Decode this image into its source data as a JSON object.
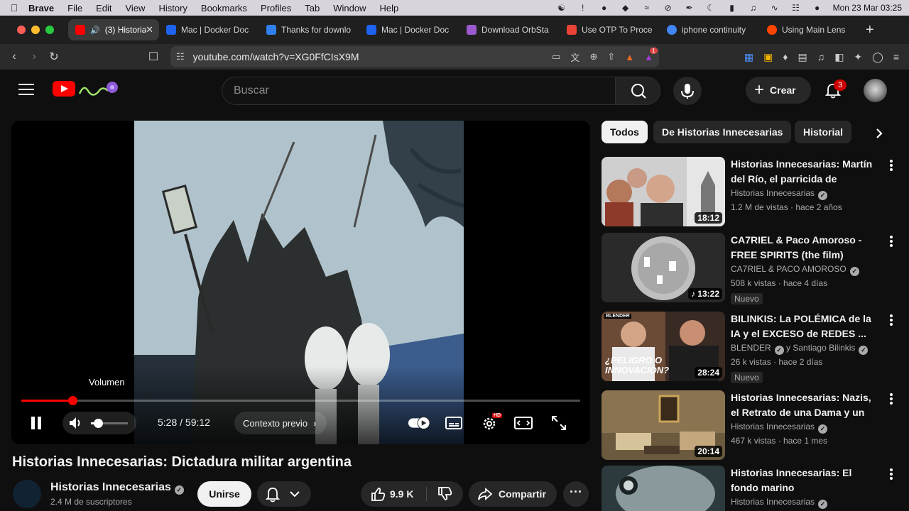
{
  "menubar": {
    "app": "Brave",
    "items": [
      "File",
      "Edit",
      "View",
      "History",
      "Bookmarks",
      "Profiles",
      "Tab",
      "Window",
      "Help"
    ],
    "clock": "Mon 23 Mar  03:25"
  },
  "tabs": [
    {
      "label": "(3) Historia",
      "color": "#ff0000"
    },
    {
      "label": "Mac | Docker Doc",
      "color": "#1d63ed"
    },
    {
      "label": "Thanks for downlo",
      "color": "#2f80ed"
    },
    {
      "label": "Mac | Docker Doc",
      "color": "#1d63ed"
    },
    {
      "label": "Download OrbSta",
      "color": "#9b59d0"
    },
    {
      "label": "Use OTP To Proce",
      "color": "#ea4335"
    },
    {
      "label": "iphone continuity",
      "color": "#4285f4"
    },
    {
      "label": "Using Main Lens",
      "color": "#ff4500"
    }
  ],
  "toolbar": {
    "url": "youtube.com/watch?v=XG0FfCIsX9M",
    "brave_badge": "1"
  },
  "header": {
    "search_placeholder": "Buscar",
    "create_label": "Crear",
    "notification_count": "3"
  },
  "player": {
    "tooltip": "Volumen",
    "time": "5:28 / 59:12",
    "context_label": "Contexto previo",
    "hd_badge": "HD",
    "progress_percent": 9.2,
    "volume_percent": 20
  },
  "video": {
    "title": "Historias Innecesarias: Dictadura militar argentina",
    "channel": "Historias Innecesarias",
    "subscribers": "2.4 M de suscriptores",
    "join_label": "Unirse",
    "like_count": "9.9 K",
    "share_label": "Compartir"
  },
  "chips": [
    "Todos",
    "De Historias Innecesarias",
    "Historial"
  ],
  "recommendations": [
    {
      "title": "Historias Innecesarias: Martín del Río, el parricida de Vicente...",
      "channel": "Historias Innecesarias",
      "verified": true,
      "meta": "1.2 M de vistas · hace 2 años",
      "duration": "18:12",
      "badge": ""
    },
    {
      "title": "CA7RIEL & Paco Amoroso - FREE SPIRITS (the film)",
      "channel": "CA7RIEL & PACO AMOROSO",
      "verified": true,
      "meta": "508 k vistas · hace 4 días",
      "duration": "13:22",
      "badge": "Nuevo"
    },
    {
      "title": "BILINKIS: La POLÉMICA de la IA y el EXCESO de REDES ...",
      "channel": "BLENDER",
      "channel_extra": "y Santiago Bilinkis",
      "verified": true,
      "meta": "26 k vistas · hace 2 días",
      "duration": "28:24",
      "badge": "Nuevo",
      "thumb_caption": "¿PELIGRO O INNOVACIÓN?",
      "thumb_logo": "BLENDER"
    },
    {
      "title": "Historias Innecesarias: Nazis, el Retrato de una Dama y un avis...",
      "channel": "Historias Innecesarias",
      "verified": true,
      "meta": "467 k vistas · hace 1 mes",
      "duration": "20:14",
      "badge": ""
    },
    {
      "title": "Historias Innecesarias: El fondo marino",
      "channel": "Historias Innecesarias",
      "verified": true,
      "meta": "",
      "duration": "",
      "badge": ""
    }
  ]
}
